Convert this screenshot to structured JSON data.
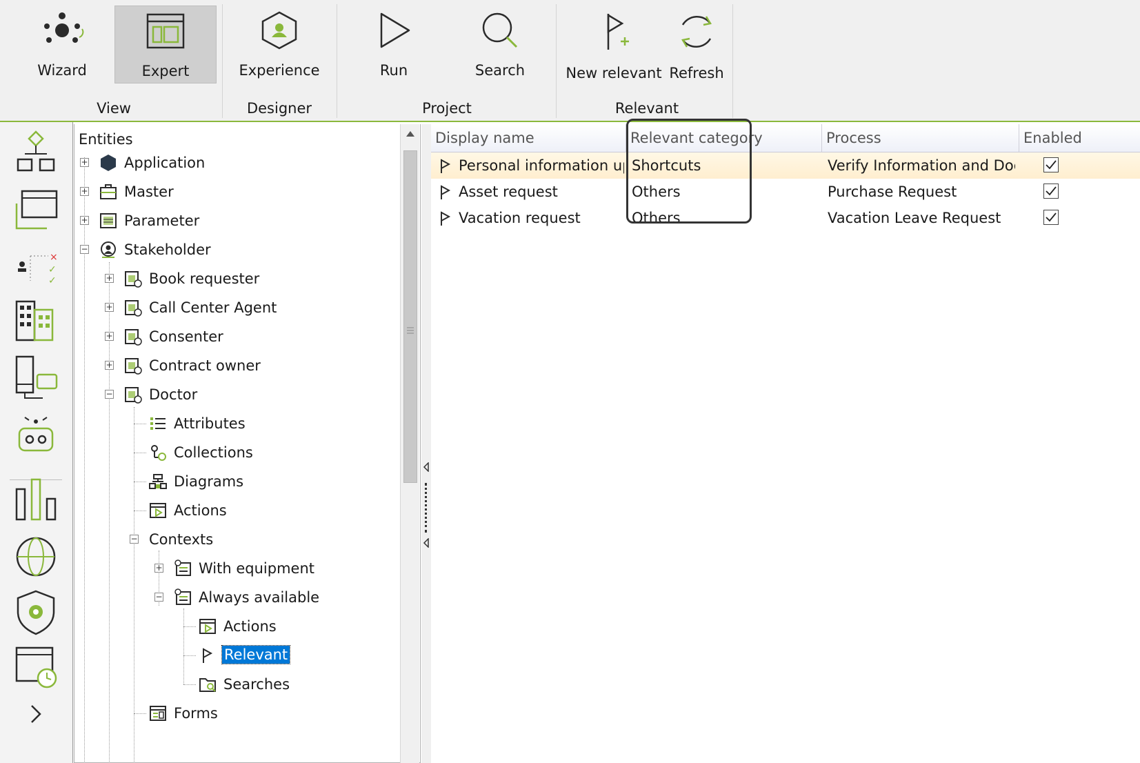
{
  "ribbon": {
    "groups": [
      {
        "label": "View",
        "buttons": [
          {
            "label": "Wizard",
            "icon": "wizard-icon"
          },
          {
            "label": "Expert",
            "icon": "expert-icon",
            "active": true
          }
        ]
      },
      {
        "label": "Designer",
        "buttons": [
          {
            "label": "Experience",
            "icon": "experience-icon"
          }
        ]
      },
      {
        "label": "Project",
        "buttons": [
          {
            "label": "Run",
            "icon": "run-icon"
          },
          {
            "label": "Search",
            "icon": "search-icon"
          }
        ]
      },
      {
        "label": "Relevant",
        "buttons": [
          {
            "label": "New relevant",
            "icon": "new-relevant-flag-icon"
          },
          {
            "label": "Refresh",
            "icon": "refresh-icon"
          }
        ]
      }
    ]
  },
  "iconbar": [
    "process-flow-icon",
    "window-icon",
    "permissions-icon",
    "organization-icon",
    "devices-icon",
    "bot-icon",
    "analytics-icon",
    "globe-icon",
    "security-shield-icon",
    "calendar-clock-icon",
    "expand-chevron-icon"
  ],
  "tree": {
    "title": "Entities",
    "nodes": [
      {
        "label": "Application",
        "icon": "cube-icon"
      },
      {
        "label": "Master",
        "icon": "briefcase-icon"
      },
      {
        "label": "Parameter",
        "icon": "table-icon"
      },
      {
        "label": "Stakeholder",
        "icon": "stakeholder-icon"
      },
      {
        "label": "Book requester",
        "icon": "entity-icon"
      },
      {
        "label": "Call Center Agent",
        "icon": "entity-icon"
      },
      {
        "label": "Consenter",
        "icon": "entity-icon"
      },
      {
        "label": "Contract owner",
        "icon": "entity-icon"
      },
      {
        "label": "Doctor",
        "icon": "entity-icon"
      },
      {
        "label": "Attributes",
        "icon": "attributes-icon"
      },
      {
        "label": "Collections",
        "icon": "collections-icon"
      },
      {
        "label": "Diagrams",
        "icon": "diagrams-icon"
      },
      {
        "label": "Actions",
        "icon": "actions-icon"
      },
      {
        "label": "Contexts",
        "icon": ""
      },
      {
        "label": "With equipment",
        "icon": "context-icon"
      },
      {
        "label": "Always available",
        "icon": "context-icon"
      },
      {
        "label": "Actions",
        "icon": "actions-icon"
      },
      {
        "label": "Relevant",
        "icon": "flag-icon",
        "selected": true
      },
      {
        "label": "Searches",
        "icon": "searches-folder-icon"
      },
      {
        "label": "Forms",
        "icon": "forms-icon"
      }
    ]
  },
  "grid": {
    "columns": [
      "Display name",
      "Relevant category",
      "Process",
      "Enabled"
    ],
    "rows": [
      {
        "display_name": "Personal information up",
        "category": "Shortcuts",
        "process": "Verify Information and Docu",
        "enabled": true
      },
      {
        "display_name": "Asset request",
        "category": "Others",
        "process": "Purchase Request",
        "enabled": true
      },
      {
        "display_name": "Vacation request",
        "category": "Others",
        "process": "Vacation Leave Request",
        "enabled": true
      }
    ]
  },
  "colors": {
    "accent": "#8ab83b",
    "selection": "#0078d7",
    "icon_dark": "#2b2b2b"
  }
}
